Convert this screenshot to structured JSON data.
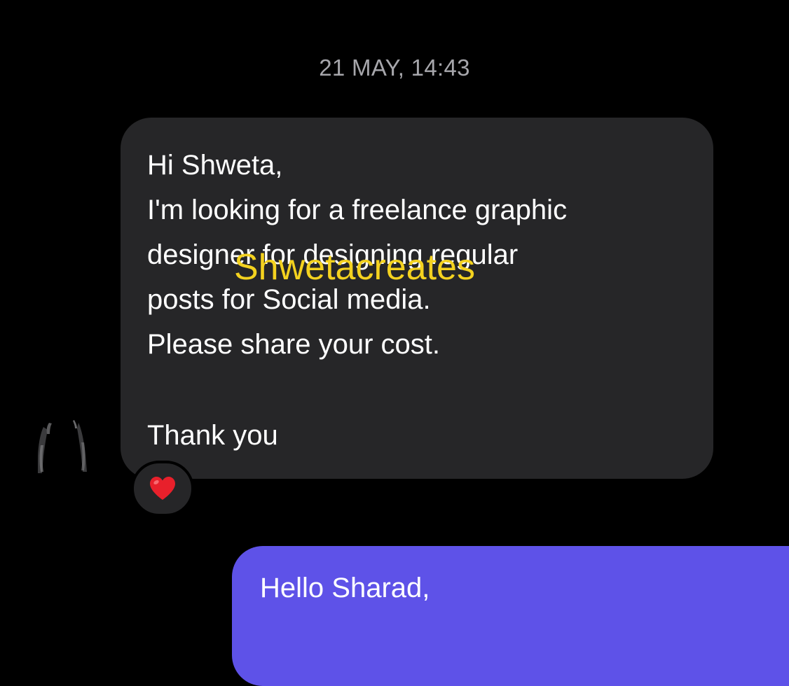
{
  "thread": {
    "timestamp": "21 MAY, 14:43"
  },
  "incoming_message": {
    "lines": [
      "Hi Shweta,",
      "I'm looking for a freelance graphic",
      "designer for designing regular",
      "posts for Social media.",
      "Please share your cost.",
      "Thank you"
    ],
    "reaction": "heart-emoji",
    "reaction_color": "#e8202b",
    "bubble_color": "#262628"
  },
  "watermark": {
    "text": "Shwetacreates",
    "color": "#f4d21f"
  },
  "outgoing_message": {
    "text": "Hello Sharad,",
    "bubble_color": "#5e52e8"
  },
  "sender_avatar": {
    "icon": "avatar-silhouette-icon"
  }
}
